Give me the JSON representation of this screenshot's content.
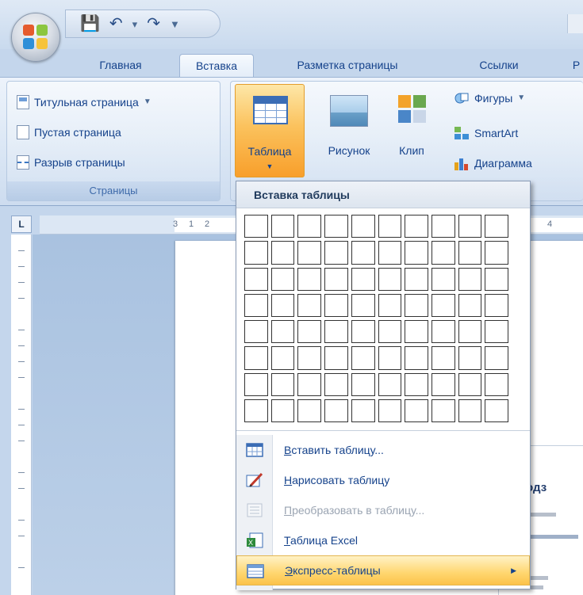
{
  "tabs": [
    {
      "label": "Главная",
      "active": false
    },
    {
      "label": "Вставка",
      "active": true
    },
    {
      "label": "Разметка страницы",
      "active": false
    },
    {
      "label": "Ссылки",
      "active": false
    },
    {
      "label": "Р",
      "active": false
    }
  ],
  "quick_access": {
    "save_icon": "save-icon",
    "undo_icon": "undo-icon",
    "redo_icon": "redo-icon"
  },
  "ribbon": {
    "pages_group": {
      "label": "Страницы",
      "items": [
        "Титульная страница",
        "Пустая страница",
        "Разрыв страницы"
      ]
    },
    "table_button": {
      "label": "Таблица"
    },
    "picture_button": {
      "label": "Рисунок"
    },
    "clip_button": {
      "label": "Клип"
    },
    "shapes_button": {
      "label": "Фигуры"
    },
    "smartart_button": {
      "label": "SmartArt"
    },
    "chart_button": {
      "label": "Диаграмма"
    }
  },
  "dropdown": {
    "title": "Вставка таблицы",
    "grid": {
      "columns": 10,
      "rows": 8
    },
    "items": [
      {
        "accel": "В",
        "rest": "ставить таблицу...",
        "enabled": true
      },
      {
        "accel": "Н",
        "rest": "арисовать таблицу",
        "enabled": true
      },
      {
        "accel": "П",
        "rest": "реобразовать в таблицу...",
        "enabled": false
      },
      {
        "accel": "Т",
        "rest": "аблица Excel",
        "enabled": true
      },
      {
        "accel": "Э",
        "rest": "кспресс-таблицы",
        "enabled": true,
        "highlighted": true,
        "submenu": true
      }
    ]
  },
  "ruler": {
    "corner_label": "L",
    "numbers": [
      "3",
      "1",
      "2",
      "4"
    ]
  },
  "document_preview": {
    "heading": "С подз"
  },
  "colors": {
    "accent": "#f89f2b",
    "ribbon": "#dbe7f5",
    "text": "#15428b"
  }
}
